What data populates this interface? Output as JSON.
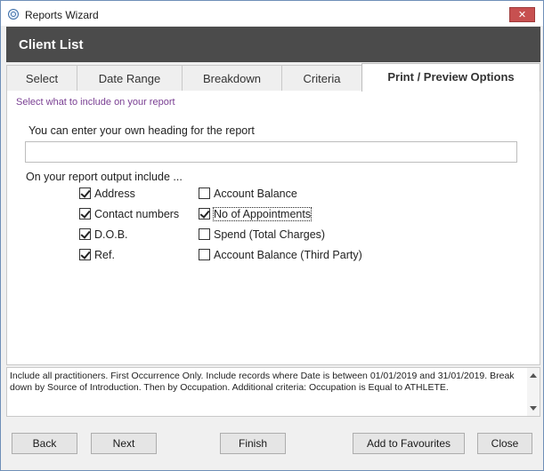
{
  "window": {
    "title": "Reports Wizard",
    "close_glyph": "✕"
  },
  "header": {
    "title": "Client List"
  },
  "tabs": [
    {
      "label": "Select"
    },
    {
      "label": "Date Range"
    },
    {
      "label": "Breakdown"
    },
    {
      "label": "Criteria"
    },
    {
      "label": "Print / Preview Options",
      "active": true
    }
  ],
  "main": {
    "hint": "Select what to include on your report",
    "heading_label": "You can enter your own heading for the report",
    "heading_value": "",
    "include_label": "On your report output include ...",
    "left_options": [
      {
        "label": "Address",
        "checked": true
      },
      {
        "label": "Contact numbers",
        "checked": true
      },
      {
        "label": "D.O.B.",
        "checked": true
      },
      {
        "label": "Ref.",
        "checked": true
      }
    ],
    "right_options": [
      {
        "label": "Account Balance",
        "checked": false
      },
      {
        "label": "No of Appointments",
        "checked": true,
        "focused": true
      },
      {
        "label": "Spend (Total Charges)",
        "checked": false
      },
      {
        "label": "Account Balance (Third Party)",
        "checked": false
      }
    ]
  },
  "summary": {
    "text": "Include all practitioners. First Occurrence Only. Include records where Date is between 01/01/2019 and 31/01/2019. Break down by Source of Introduction. Then by Occupation. Additional criteria: Occupation is Equal to ATHLETE."
  },
  "buttons": {
    "back": "Back",
    "next": "Next",
    "finish": "Finish",
    "add_to_favourites": "Add to Favourites",
    "close": "Close"
  },
  "colors": {
    "header_bg": "#4b4b4b",
    "hint_text": "#7a3f93",
    "close_button": "#c75050"
  }
}
